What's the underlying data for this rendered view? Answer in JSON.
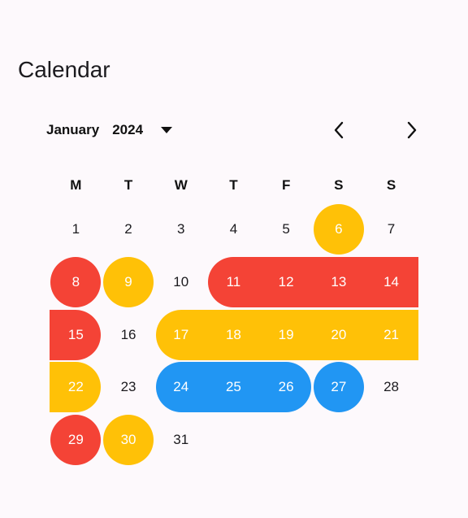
{
  "app": {
    "title": "Calendar"
  },
  "header": {
    "month": "January",
    "year": "2024"
  },
  "weekdays": [
    "M",
    "T",
    "W",
    "T",
    "F",
    "S",
    "S"
  ],
  "colors": {
    "red": "#f44336",
    "amber": "#ffc107",
    "blue": "#2196f3",
    "background": "#fdf9fc"
  },
  "days": [
    "1",
    "2",
    "3",
    "4",
    "5",
    "6",
    "7",
    "8",
    "9",
    "10",
    "11",
    "12",
    "13",
    "14",
    "15",
    "16",
    "17",
    "18",
    "19",
    "20",
    "21",
    "22",
    "23",
    "24",
    "25",
    "26",
    "27",
    "28",
    "29",
    "30",
    "31"
  ],
  "events": [
    {
      "color": "amber",
      "days": [
        6
      ]
    },
    {
      "color": "red",
      "days": [
        8
      ]
    },
    {
      "color": "amber",
      "days": [
        9
      ]
    },
    {
      "color": "red",
      "days": [
        11,
        12,
        13,
        14,
        15
      ]
    },
    {
      "color": "amber",
      "days": [
        17,
        18,
        19,
        20,
        21,
        22
      ]
    },
    {
      "color": "blue",
      "days": [
        24,
        25,
        26
      ]
    },
    {
      "color": "blue",
      "days": [
        27
      ]
    },
    {
      "color": "red",
      "days": [
        29
      ]
    },
    {
      "color": "amber",
      "days": [
        30
      ]
    }
  ]
}
